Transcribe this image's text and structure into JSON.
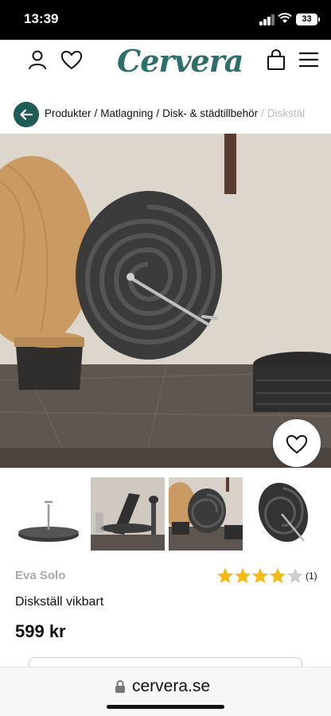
{
  "status_bar": {
    "time": "13:39",
    "battery": "33"
  },
  "header": {
    "logo": "Cervera",
    "icons": [
      "user-icon",
      "heart-icon",
      "bag-icon",
      "menu-icon"
    ]
  },
  "breadcrumb": {
    "items": [
      "Produkter",
      "Matlagning",
      "Disk- & städtillbehör"
    ],
    "current": "Diskstäl"
  },
  "product": {
    "brand": "Eva Solo",
    "title": "Diskställ vikbart",
    "price": "599 kr",
    "rating": {
      "stars": 4,
      "max": 5,
      "count": "(1)"
    }
  },
  "colors": {
    "brand": "#2f6f6b",
    "back_button": "#1f5c55",
    "star": "#f5b90f",
    "star_empty": "#cfcfcf"
  },
  "browser": {
    "url": "cervera.se"
  }
}
